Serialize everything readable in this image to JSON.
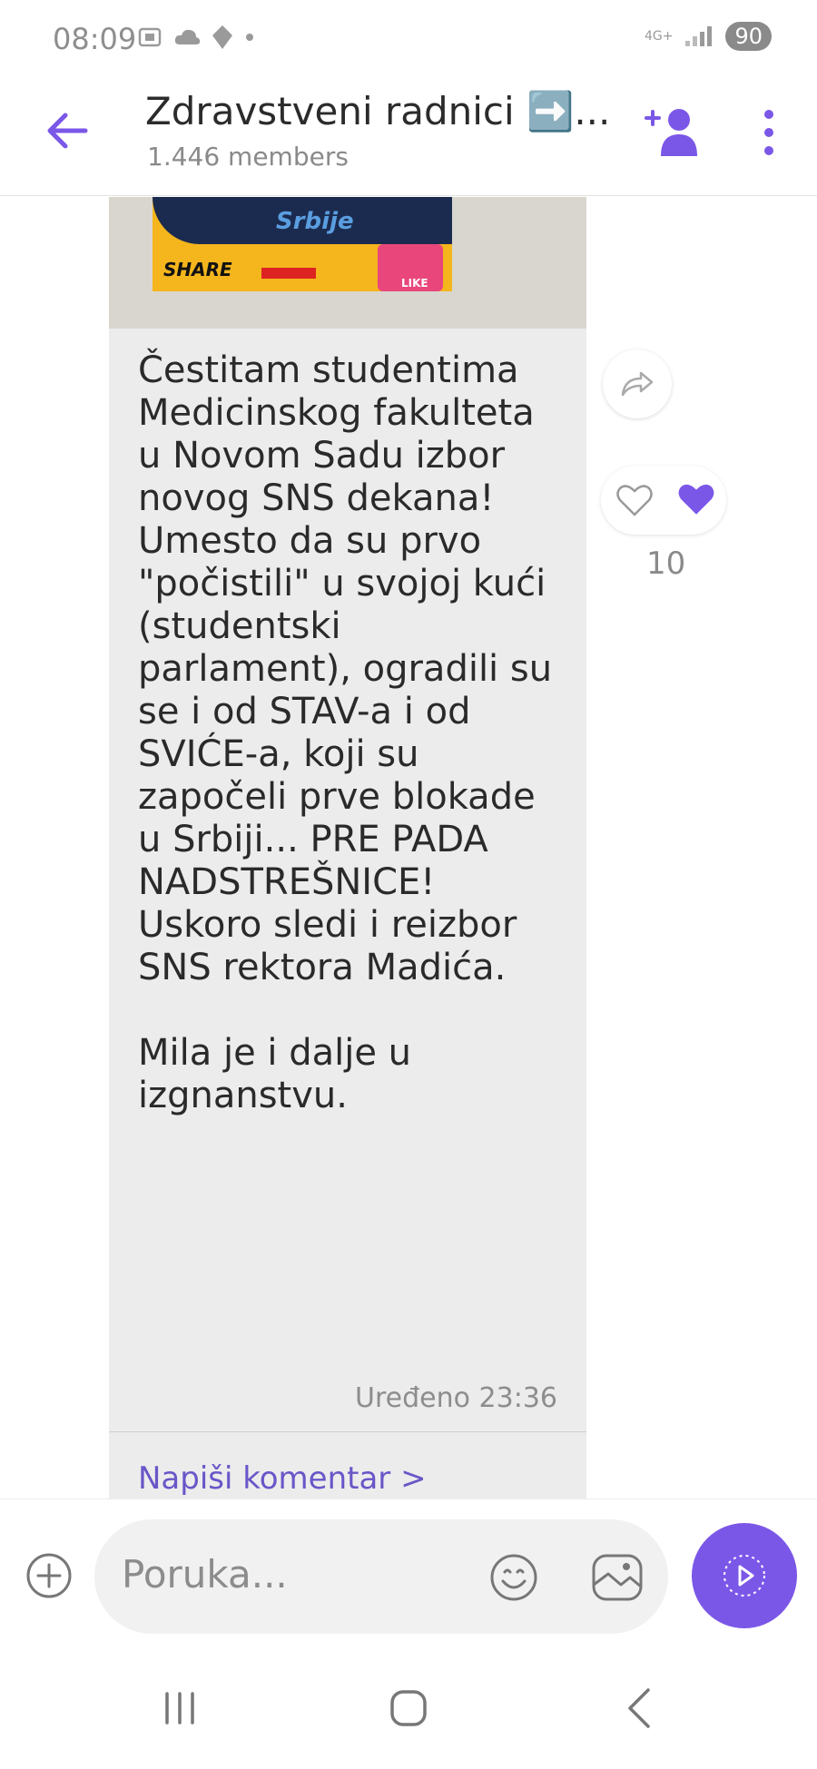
{
  "status_bar": {
    "time": "08:09",
    "network": "4G+",
    "battery": "90"
  },
  "header": {
    "title": "Zdravstveni radnici ➡️...",
    "members": "1.446 members"
  },
  "message": {
    "media_text_srbije": "Srbije",
    "media_text_share": "SHARE",
    "media_text_like": "LIKE",
    "text": "Čestitam studentima Medicinskog fakulteta u Novom Sadu izbor novog SNS dekana!\nUmesto da su prvo \"počistili\" u svojoj kući (studentski parlament), ogradili su se i od STAV-a i od SVIĆE-a, koji su započeli prve blokade u Srbiji... PRE PADA NADSTREŠNICE!\nUskoro sledi i reizbor SNS rektora Madića.\n\nMila je i dalje u izgnanstvu.",
    "edited_label": "Uređeno",
    "time": "23:36",
    "comment_link": "Napiši komentar >",
    "reaction_count": "10"
  },
  "composer": {
    "placeholder": "Poruka..."
  },
  "colors": {
    "accent": "#7b57e8",
    "link": "#6a56c8",
    "bubble": "#ececec"
  },
  "icons": {
    "back": "arrow-left-icon",
    "add_member": "add-member-icon",
    "more": "more-vertical-icon",
    "forward": "forward-icon",
    "like": "heart-outline-icon",
    "liked": "heart-filled-icon",
    "plus": "plus-circle-icon",
    "emoji": "emoji-icon",
    "sticker": "sticker-icon",
    "send": "send-icon"
  }
}
